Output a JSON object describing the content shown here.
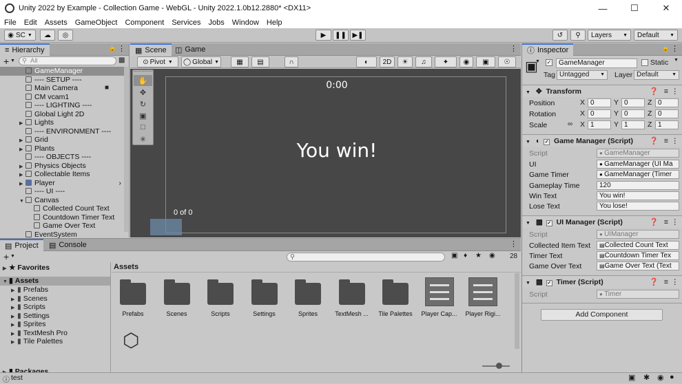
{
  "window": {
    "title": "Unity 2022 by Example - Collection Game - WebGL - Unity 2022.1.0b12.2880* <DX11>"
  },
  "menu": [
    "File",
    "Edit",
    "Assets",
    "GameObject",
    "Component",
    "Services",
    "Jobs",
    "Window",
    "Help"
  ],
  "toolbar": {
    "account": "SC",
    "layers": "Layers",
    "layout": "Default"
  },
  "hierarchy": {
    "tab": "Hierarchy",
    "search_placeholder": "All",
    "items": [
      {
        "label": "GameManager",
        "indent": 1,
        "selected": true
      },
      {
        "label": "---- SETUP ----",
        "indent": 1
      },
      {
        "label": "Main Camera",
        "indent": 1
      },
      {
        "label": "CM vcam1",
        "indent": 1
      },
      {
        "label": "---- LIGHTING ----",
        "indent": 1
      },
      {
        "label": "Global Light 2D",
        "indent": 1
      },
      {
        "label": "Lights",
        "indent": 1,
        "arrow": true
      },
      {
        "label": "---- ENVIRONMENT ----",
        "indent": 1
      },
      {
        "label": "Grid",
        "indent": 1,
        "arrow": true
      },
      {
        "label": "Plants",
        "indent": 1,
        "arrow": true
      },
      {
        "label": "---- OBJECTS ----",
        "indent": 1
      },
      {
        "label": "Physics Objects",
        "indent": 1,
        "arrow": true
      },
      {
        "label": "Collectable Items",
        "indent": 1,
        "arrow": true
      },
      {
        "label": "Player",
        "indent": 1,
        "arrow": true,
        "prefab": true
      },
      {
        "label": "---- UI ----",
        "indent": 1
      },
      {
        "label": "Canvas",
        "indent": 1,
        "arrow": true,
        "expanded": true
      },
      {
        "label": "Collected Count Text",
        "indent": 2
      },
      {
        "label": "Countdown Timer Text",
        "indent": 2
      },
      {
        "label": "Game Over Text",
        "indent": 2
      },
      {
        "label": "EventSystem",
        "indent": 1
      }
    ]
  },
  "scene": {
    "tabs": [
      "Scene",
      "Game"
    ],
    "pivot": "Pivot",
    "global": "Global",
    "mode2d": "2D",
    "timer_text": "0:00",
    "win_text": "You win!",
    "count_text": "0 of 0"
  },
  "inspector": {
    "tab": "Inspector",
    "object_name": "GameManager",
    "static_label": "Static",
    "tag_label": "Tag",
    "tag_value": "Untagged",
    "layer_label": "Layer",
    "layer_value": "Default",
    "transform": {
      "title": "Transform",
      "position_label": "Position",
      "rotation_label": "Rotation",
      "scale_label": "Scale",
      "position": [
        "0",
        "0",
        "0"
      ],
      "rotation": [
        "0",
        "0",
        "0"
      ],
      "scale": [
        "1",
        "1",
        "1"
      ]
    },
    "game_manager": {
      "title": "Game Manager (Script)",
      "script_label": "Script",
      "script_value": "GameManager",
      "ui_label": "UI",
      "ui_value": "GameManager (UI Ma",
      "timer_label": "Game Timer",
      "timer_value": "GameManager (Timer",
      "gameplay_label": "Gameplay Time",
      "gameplay_value": "120",
      "win_label": "Win Text",
      "win_value": "You win!",
      "lose_label": "Lose Text",
      "lose_value": "You lose!"
    },
    "ui_manager": {
      "title": "UI Manager (Script)",
      "script_label": "Script",
      "script_value": "UIManager",
      "collected_label": "Collected Item Text",
      "collected_value": "Collected Count Text",
      "timer_label": "Timer Text",
      "timer_value": "Countdown Timer Tex",
      "gameover_label": "Game Over Text",
      "gameover_value": "Game Over Text (Text"
    },
    "timer": {
      "title": "Timer (Script)",
      "script_label": "Script",
      "script_value": "Timer"
    },
    "add_component": "Add Component"
  },
  "project": {
    "tabs": [
      "Project",
      "Console"
    ],
    "search_value": "",
    "hidden_count": "28",
    "favorites": "Favorites",
    "assets_root": "Assets",
    "tree": [
      "Prefabs",
      "Scenes",
      "Scripts",
      "Settings",
      "Sprites",
      "TextMesh Pro",
      "Tile Palettes"
    ],
    "packages": "Packages",
    "breadcrumb": "Assets",
    "items": [
      "Prefabs",
      "Scenes",
      "Scripts",
      "Settings",
      "Sprites",
      "TextMesh ...",
      "Tile Palettes",
      "Player Cap...",
      "Player Rigi..."
    ]
  },
  "status": {
    "text": "test"
  },
  "colors": {
    "accent": "#3a72d8",
    "selection": "#8e8e8e",
    "scene_bg": "#474747"
  }
}
